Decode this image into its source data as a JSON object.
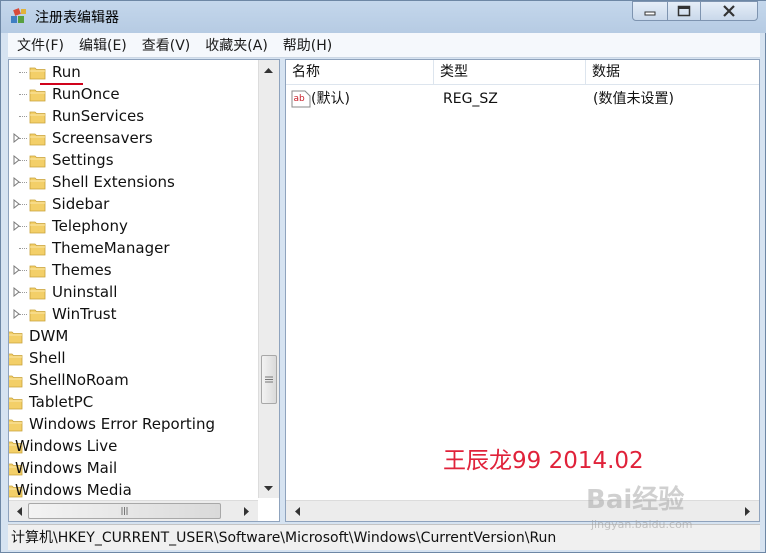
{
  "window": {
    "title": "注册表编辑器"
  },
  "menu": [
    "文件(F)",
    "编辑(E)",
    "查看(V)",
    "收藏夹(A)",
    "帮助(H)"
  ],
  "tree": [
    {
      "label": "Run",
      "selected": true,
      "expander": false
    },
    {
      "label": "RunOnce",
      "expander": false
    },
    {
      "label": "RunServices",
      "expander": false
    },
    {
      "label": "Screensavers",
      "expander": true
    },
    {
      "label": "Settings",
      "expander": true
    },
    {
      "label": "Shell Extensions",
      "expander": true
    },
    {
      "label": "Sidebar",
      "expander": true
    },
    {
      "label": "Telephony",
      "expander": true
    },
    {
      "label": "ThemeManager",
      "expander": false
    },
    {
      "label": "Themes",
      "expander": true
    },
    {
      "label": "Uninstall",
      "expander": true
    },
    {
      "label": "WinTrust",
      "expander": true
    },
    {
      "label": "DWM"
    },
    {
      "label": "Shell"
    },
    {
      "label": "ShellNoRoam"
    },
    {
      "label": "TabletPC"
    },
    {
      "label": "Windows Error Reporting"
    },
    {
      "label": "Windows Live"
    },
    {
      "label": "Windows Mail"
    },
    {
      "label": "Windows Media"
    }
  ],
  "list": {
    "headers": {
      "name": "名称",
      "type": "类型",
      "data": "数据"
    },
    "rows": [
      {
        "icon": "string-value-icon",
        "icon_text": "ab",
        "name": "(默认)",
        "type": "REG_SZ",
        "data": "(数值未设置)"
      }
    ]
  },
  "status": "计算机\\HKEY_CURRENT_USER\\Software\\Microsoft\\Windows\\CurrentVersion\\Run",
  "watermark": "王辰龙99 2014.02",
  "baidu": {
    "logo": "Bai经验",
    "url": "jingyan.baidu.com"
  },
  "colors": {
    "watermark": "#e0223a",
    "selected_underline": "#d0021b",
    "folder": "#f3cf68"
  }
}
